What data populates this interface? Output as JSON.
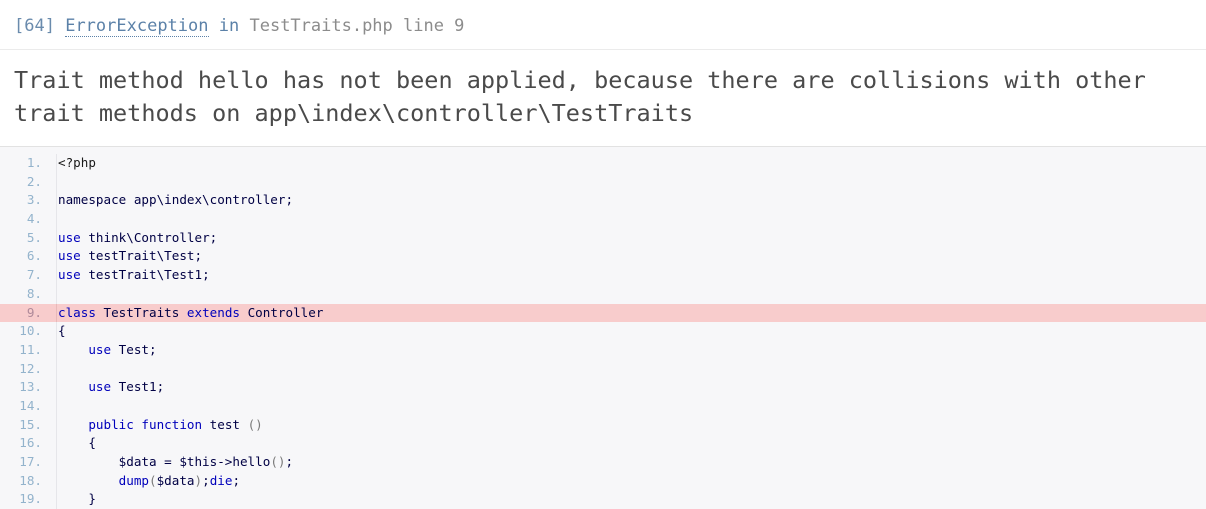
{
  "exception": {
    "code": "[64]",
    "class": "ErrorException",
    "preposition": "in",
    "location": "TestTraits.php line 9",
    "message": "Trait method hello has not been applied, because there are collisions with other trait methods on app\\index\\controller\\TestTraits"
  },
  "colors": {
    "link": "#5b81a8",
    "muted": "#8c8c8c",
    "message_text": "#4a4a4a",
    "code_background": "#f7f7f9",
    "error_line_background": "#f8cccc",
    "line_number": "#93b3cc",
    "keyword": "#0000bb",
    "identifier": "#000044",
    "punctuation": "#7b7b7b"
  },
  "source": {
    "error_line": 9,
    "lines": [
      {
        "n": "1.",
        "tokens": [
          {
            "t": "<?php",
            "c": "t-plain"
          }
        ]
      },
      {
        "n": "2.",
        "tokens": [
          {
            "t": "",
            "c": "t-plain"
          }
        ]
      },
      {
        "n": "3.",
        "tokens": [
          {
            "t": "namespace app\\index\\controller;",
            "c": "t-default"
          }
        ]
      },
      {
        "n": "4.",
        "tokens": [
          {
            "t": "",
            "c": "t-plain"
          }
        ]
      },
      {
        "n": "5.",
        "tokens": [
          {
            "t": "use",
            "c": "t-kw"
          },
          {
            "t": " think\\Controller;",
            "c": "t-default"
          }
        ]
      },
      {
        "n": "6.",
        "tokens": [
          {
            "t": "use",
            "c": "t-kw"
          },
          {
            "t": " testTrait\\Test;",
            "c": "t-default"
          }
        ]
      },
      {
        "n": "7.",
        "tokens": [
          {
            "t": "use",
            "c": "t-kw"
          },
          {
            "t": " testTrait\\Test1;",
            "c": "t-default"
          }
        ]
      },
      {
        "n": "8.",
        "tokens": [
          {
            "t": "",
            "c": "t-plain"
          }
        ]
      },
      {
        "n": "9.",
        "tokens": [
          {
            "t": "class",
            "c": "t-kw"
          },
          {
            "t": " TestTraits ",
            "c": "t-default"
          },
          {
            "t": "extends",
            "c": "t-kw"
          },
          {
            "t": " Controller",
            "c": "t-default"
          }
        ]
      },
      {
        "n": "10.",
        "tokens": [
          {
            "t": "{",
            "c": "t-default"
          }
        ]
      },
      {
        "n": "11.",
        "tokens": [
          {
            "t": "    ",
            "c": "t-plain"
          },
          {
            "t": "use",
            "c": "t-kw"
          },
          {
            "t": " Test;",
            "c": "t-default"
          }
        ]
      },
      {
        "n": "12.",
        "tokens": [
          {
            "t": "",
            "c": "t-plain"
          }
        ]
      },
      {
        "n": "13.",
        "tokens": [
          {
            "t": "    ",
            "c": "t-plain"
          },
          {
            "t": "use",
            "c": "t-kw"
          },
          {
            "t": " Test1;",
            "c": "t-default"
          }
        ]
      },
      {
        "n": "14.",
        "tokens": [
          {
            "t": "",
            "c": "t-plain"
          }
        ]
      },
      {
        "n": "15.",
        "tokens": [
          {
            "t": "    ",
            "c": "t-plain"
          },
          {
            "t": "public function",
            "c": "t-kw"
          },
          {
            "t": " test ",
            "c": "t-default"
          },
          {
            "t": "()",
            "c": "t-punc"
          }
        ]
      },
      {
        "n": "16.",
        "tokens": [
          {
            "t": "    {",
            "c": "t-default"
          }
        ]
      },
      {
        "n": "17.",
        "tokens": [
          {
            "t": "        $data = $this->hello",
            "c": "t-var"
          },
          {
            "t": "()",
            "c": "t-punc"
          },
          {
            "t": ";",
            "c": "t-var"
          }
        ]
      },
      {
        "n": "18.",
        "tokens": [
          {
            "t": "        dump",
            "c": "t-kw"
          },
          {
            "t": "(",
            "c": "t-punc"
          },
          {
            "t": "$data",
            "c": "t-var"
          },
          {
            "t": ")",
            "c": "t-punc"
          },
          {
            "t": ";",
            "c": "t-var"
          },
          {
            "t": "die",
            "c": "t-kw"
          },
          {
            "t": ";",
            "c": "t-var"
          }
        ]
      },
      {
        "n": "19.",
        "tokens": [
          {
            "t": "    }",
            "c": "t-default"
          }
        ]
      }
    ]
  }
}
